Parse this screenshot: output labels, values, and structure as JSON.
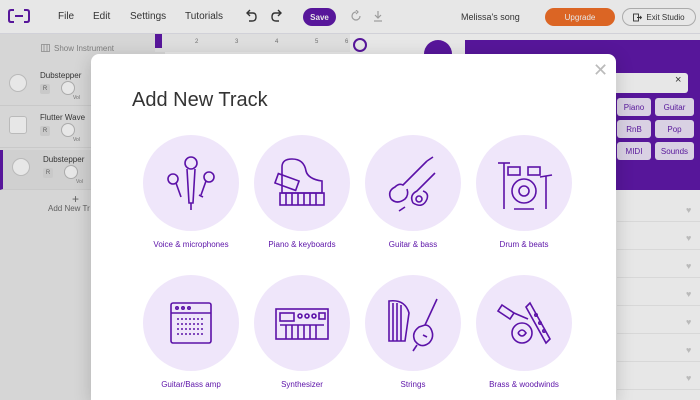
{
  "menu": {
    "file": "File",
    "edit": "Edit",
    "settings": "Settings",
    "tutorials": "Tutorials"
  },
  "toolbar": {
    "save_label": "Save",
    "song_title": "Melissa's song",
    "upgrade_label": "Upgrade",
    "exit_label": "Exit Studio"
  },
  "left_panel": {
    "show_instrument": "Show Instrument",
    "tracks": [
      {
        "name": "Dubstepper",
        "r": "R",
        "vol": "Vol"
      },
      {
        "name": "Flutter Wave",
        "r": "R",
        "vol": "Vol"
      },
      {
        "name": "Dubstepper",
        "r": "R",
        "vol": "Vol"
      }
    ],
    "add_track": "Add New Tr"
  },
  "ruler": {
    "marks": [
      "2",
      "3",
      "4",
      "5",
      "6"
    ]
  },
  "right_panel": {
    "chips": [
      "Piano",
      "Guitar",
      "RnB",
      "Pop",
      "MIDI",
      "Sounds"
    ]
  },
  "modal": {
    "title": "Add New Track",
    "categories": [
      {
        "label": "Voice & microphones",
        "icon": "microphones-icon"
      },
      {
        "label": "Piano & keyboards",
        "icon": "piano-icon"
      },
      {
        "label": "Guitar & bass",
        "icon": "guitar-icon"
      },
      {
        "label": "Drum & beats",
        "icon": "drums-icon"
      },
      {
        "label": "Guitar/Bass amp",
        "icon": "amp-icon"
      },
      {
        "label": "Synthesizer",
        "icon": "synthesizer-icon"
      },
      {
        "label": "Strings",
        "icon": "strings-icon"
      },
      {
        "label": "Brass & woodwinds",
        "icon": "brass-icon"
      }
    ]
  },
  "colors": {
    "accent": "#5c12a8",
    "upgrade": "#f26b21",
    "circle_bg": "#efe6fa"
  }
}
